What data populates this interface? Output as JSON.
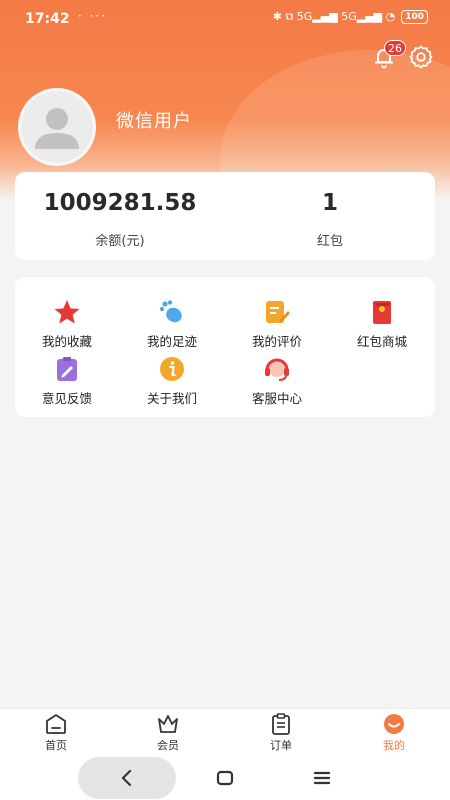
{
  "status_bar": {
    "time": "17:42",
    "extra": "· ···",
    "icons": "✱ ⧉ 5G▂▄▆ 5G▂▄▆ ◔",
    "battery": "100"
  },
  "header": {
    "notification_count": "26",
    "username": "微信用户",
    "bell_icon": "bell-icon",
    "settings_icon": "gear-icon"
  },
  "balance": {
    "amount_value": "1009281.58",
    "amount_label": "余额(元)",
    "redpacket_value": "1",
    "redpacket_label": "红包"
  },
  "menu": {
    "items": [
      {
        "label": "我的收藏",
        "icon": "star-icon",
        "color": "#e53935"
      },
      {
        "label": "我的足迹",
        "icon": "footprint-icon",
        "color": "#4fa8e8"
      },
      {
        "label": "我的评价",
        "icon": "review-icon",
        "color": "#f4a62a"
      },
      {
        "label": "红包商城",
        "icon": "red-envelope-icon",
        "color": "#e53935"
      },
      {
        "label": "意见反馈",
        "icon": "feedback-icon",
        "color": "#9b6fe0"
      },
      {
        "label": "关于我们",
        "icon": "info-icon",
        "color": "#f4a62a"
      },
      {
        "label": "客服中心",
        "icon": "customer-service-icon",
        "color": "#e53935"
      }
    ]
  },
  "tabbar": {
    "tabs": [
      {
        "label": "首页",
        "icon": "home-icon"
      },
      {
        "label": "会员",
        "icon": "crown-icon"
      },
      {
        "label": "订单",
        "icon": "clipboard-icon"
      },
      {
        "label": "我的",
        "icon": "profile-face-icon"
      }
    ],
    "active_color": "#f47a45"
  },
  "nav": {
    "back": "back-icon",
    "home": "home-square-icon",
    "menu": "menu-lines-icon"
  }
}
